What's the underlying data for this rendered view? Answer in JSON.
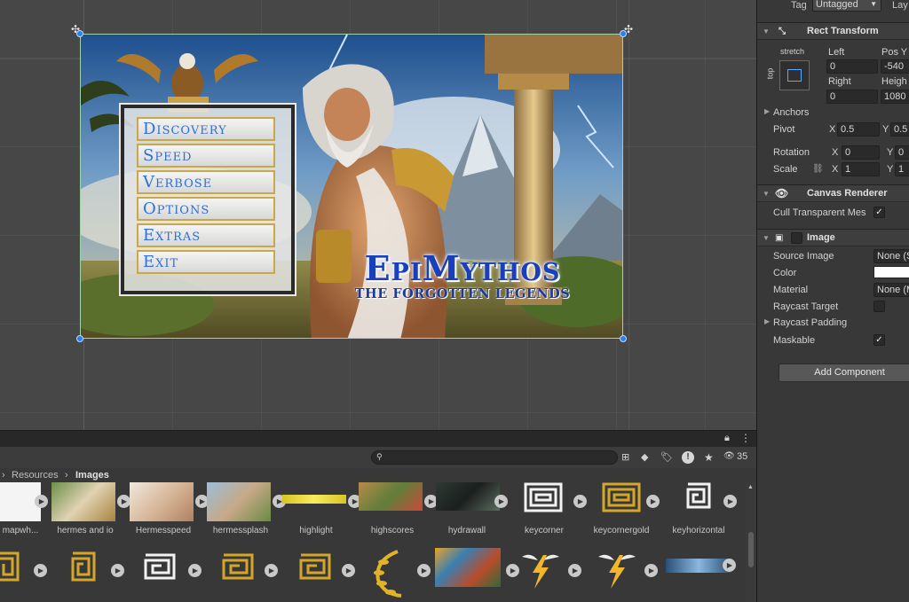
{
  "inspector": {
    "tag_label": "Tag",
    "tag_value": "Untagged",
    "layer_label": "Lay",
    "rect_transform": {
      "title": "Rect Transform",
      "stretch_label": "stretch",
      "top_label": "top",
      "left_label": "Left",
      "left_value": "0",
      "posy_label": "Pos Y",
      "posy_value": "-540",
      "right_label": "Right",
      "right_value": "0",
      "height_label": "Heigh",
      "height_value": "1080",
      "anchors_label": "Anchors",
      "pivot_label": "Pivot",
      "pivot_x": "0.5",
      "pivot_y": "0.5",
      "rotation_label": "Rotation",
      "rotation_x": "0",
      "rotation_y": "0",
      "scale_label": "Scale",
      "scale_x": "1",
      "scale_y": "1",
      "x_label": "X",
      "y_label": "Y"
    },
    "canvas_renderer": {
      "title": "Canvas Renderer",
      "cull_label": "Cull Transparent Mes",
      "cull_checked": "✓"
    },
    "image": {
      "title": "Image",
      "source_label": "Source Image",
      "source_value": "None (S",
      "color_label": "Color",
      "material_label": "Material",
      "material_value": "None (M",
      "raycast_target_label": "Raycast Target",
      "raycast_padding_label": "Raycast Padding",
      "maskable_label": "Maskable",
      "maskable_checked": "✓"
    },
    "add_component": "Add Component"
  },
  "scene": {
    "menu": [
      "Discovery",
      "Speed",
      "Verbose",
      "Options",
      "Extras",
      "Exit"
    ],
    "logo_main": "EpiMythos",
    "logo_sub": "THE FORGOTTEN LEGENDS"
  },
  "project": {
    "search_value": "",
    "count": "35",
    "breadcrumb": [
      "Resources",
      "Images"
    ],
    "assets_row1": [
      {
        "label": "mapwh...",
        "icon": "map-thumb"
      },
      {
        "label": "hermes and io",
        "icon": "hermes-io-thumb"
      },
      {
        "label": "Hermesspeed",
        "icon": "hermes-speed-thumb"
      },
      {
        "label": "hermessplash",
        "icon": "hermes-splash-thumb"
      },
      {
        "label": "highlight",
        "icon": "highlight-thumb"
      },
      {
        "label": "highscores",
        "icon": "highscores-thumb"
      },
      {
        "label": "hydrawall",
        "icon": "hydra-thumb"
      },
      {
        "label": "keycorner",
        "icon": "greek-key-thumb"
      },
      {
        "label": "keycornergold",
        "icon": "greek-key-gold-thumb"
      },
      {
        "label": "keyhorizontal",
        "icon": "greek-key-horizontal-thumb"
      }
    ],
    "assets_row2": [
      "key-gold-1",
      "key-gold-2",
      "key-white",
      "key-gold-3",
      "key-gold-4",
      "laurel",
      "painting",
      "lightning-wings-1",
      "lightning-wings-2",
      "bar-blue"
    ]
  },
  "colors": {
    "accent_blue": "#2f7fe8",
    "menu_text": "#2f6fd6",
    "menu_border": "#c9a84a",
    "gold": "#d4a72c"
  }
}
